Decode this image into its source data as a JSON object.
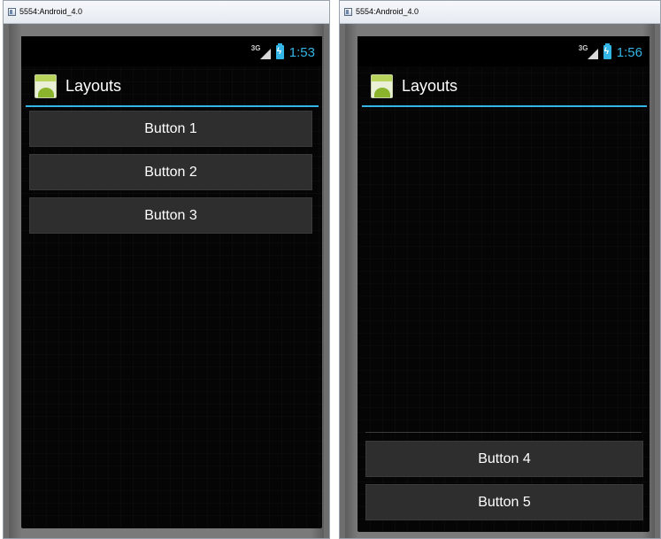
{
  "left_window": {
    "title": "5554:Android_4.0",
    "status": {
      "network": "3G",
      "time": "1:53"
    },
    "action_bar": {
      "title": "Layouts"
    },
    "buttons": [
      "Button 1",
      "Button 2",
      "Button 3"
    ]
  },
  "right_window": {
    "title": "5554:Android_4.0",
    "status": {
      "network": "3G",
      "time": "1:56"
    },
    "action_bar": {
      "title": "Layouts"
    },
    "buttons": [
      "Button 4",
      "Button 5"
    ]
  },
  "colors": {
    "accent": "#33b5e5",
    "button_bg": "#2e2e2e",
    "screen_bg": "#050505"
  }
}
